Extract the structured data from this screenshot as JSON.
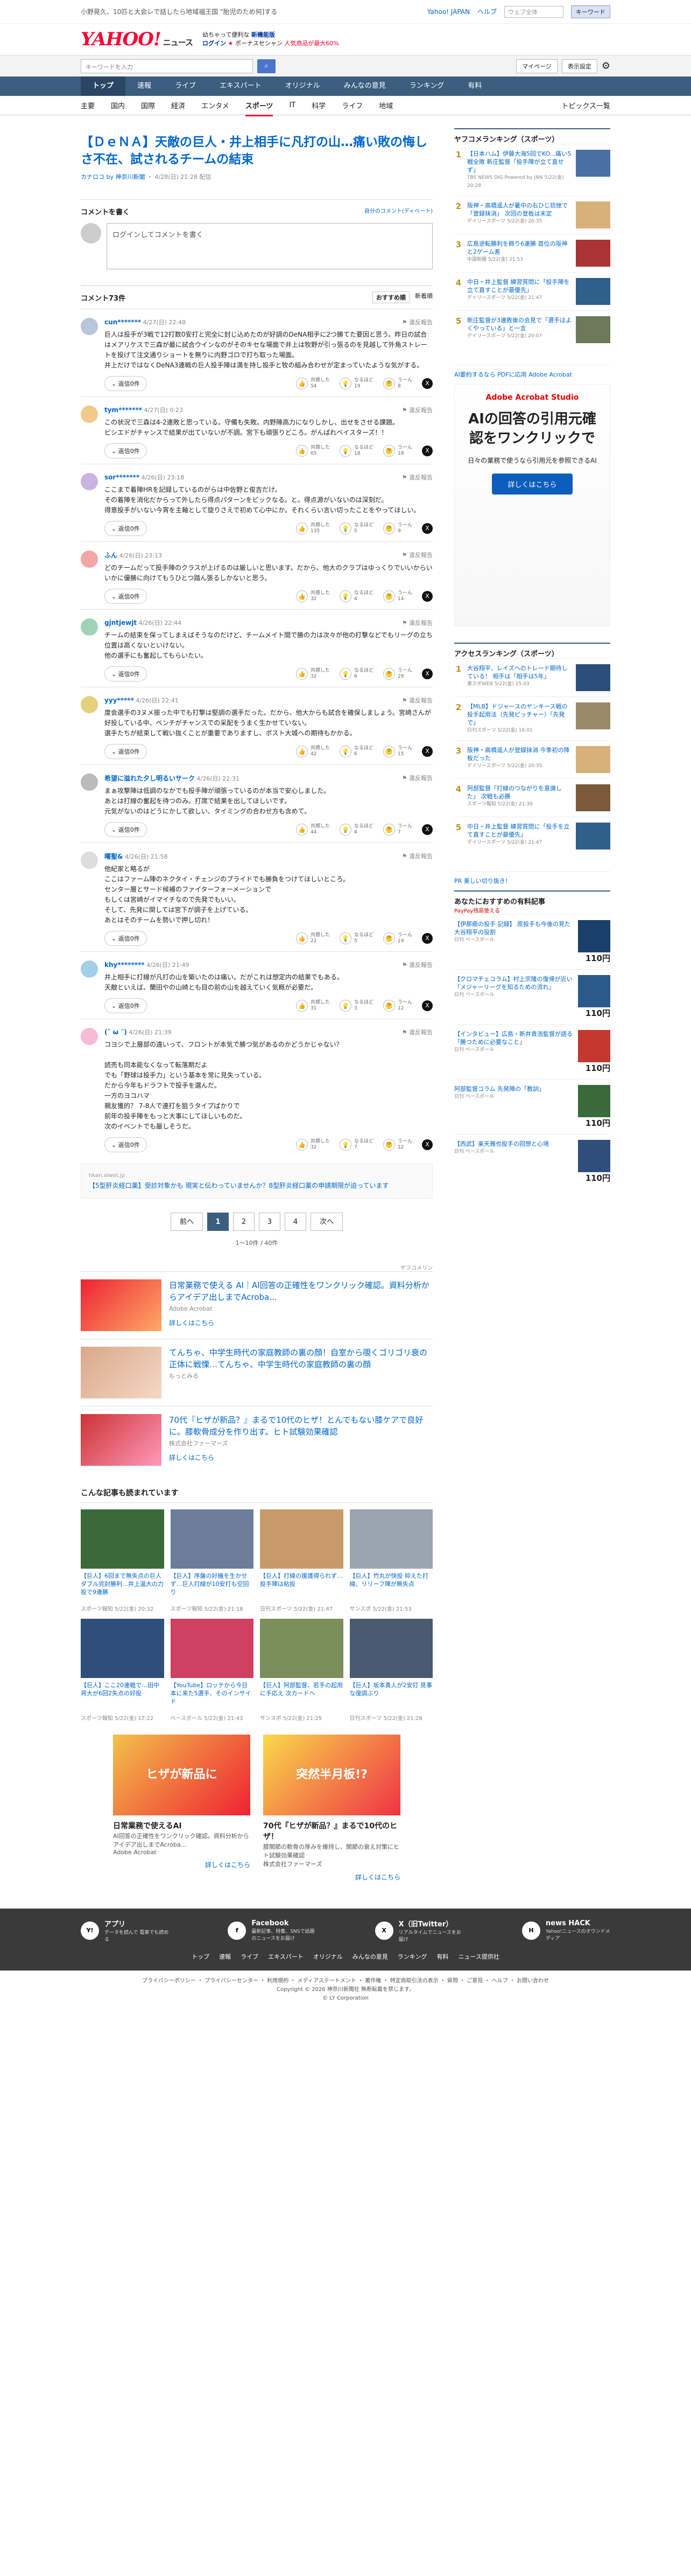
{
  "top": {
    "left": "小野晃久、10匹と大会レで話したら地域福王国 \"胎児のため何]する",
    "yahoo_link": "Yahoo! JAPAN",
    "help": "ヘルプ",
    "search_placeholder": "ウェブ全体",
    "search_btn": "キーワード"
  },
  "brand": {
    "logo": "YAHOO!",
    "logo_sub": "ニュース",
    "line1": "幼ちゃって便利な",
    "line1b": "新機能版",
    "login": "ログイン",
    "line2": "ポーナスセシャン",
    "line2b": "人気商品が最大60%"
  },
  "searchrow": {
    "placeholder": "キーワードを入力",
    "mypage": "マイページ",
    "settings": "表示設定"
  },
  "navmain": [
    "トップ",
    "速報",
    "ライブ",
    "エキスパート",
    "オリジナル",
    "みんなの意見",
    "ランキング",
    "有料"
  ],
  "navmain_active": 0,
  "navsub": [
    "主要",
    "国内",
    "国際",
    "経済",
    "エンタメ",
    "スポーツ",
    "IT",
    "科学",
    "ライフ",
    "地域"
  ],
  "navsub_active": 5,
  "navsub_tail": "トピックス一覧",
  "article": {
    "title": "【ＤｅＮＡ】天敵の巨人・井上相手に凡打の山…痛い敗の悔しさ不在、試されるチームの結束",
    "source": "カナロコ by 神奈川新聞",
    "date": "4/28(日) 21:28 配信"
  },
  "comment_box": {
    "title": "コメントを書く",
    "link": "自分のコメント(ディベート)",
    "placeholder": "ログインしてコメントを書く"
  },
  "comments_head": {
    "title": "コメント73件",
    "sort_a": "おすすめ順",
    "sort_b": "新着順"
  },
  "labels": {
    "reply": "返信0件",
    "report": "違反報告",
    "react1": "共感した",
    "react2": "なるほど",
    "react3": "うーん"
  },
  "comments": [
    {
      "user": "cun*******",
      "date": "4/27(日) 22:48",
      "text": "巨人は投手が3戦で12打数0安打と完全に封じ込めたのが好調のDeNA相手に2つ勝てた要因と思う。昨日の試合はメアリケスで三森が最に試合ウインなのがそのキセな場面で井上は牧野が引っ張るのを見越して外角ストレートを投げて注文通りショートを無りに内野ゴロで打ち取った場面。\n井上だけではなくDeNA3連戦の巨人投手陣は満を持し投手と牧の組み合わせが定まっていたような気がする。",
      "r1": "54",
      "r2": "19",
      "r3": "8"
    },
    {
      "user": "tym*******",
      "date": "4/27(日) 0:23",
      "text": "この状況で三森は4-2連敗と思っている。守備も失敗。内野陣高力になりしかし、出せをさせる課題。\nビシエドがチャンスで結果が出ていないが不調。宮下も頑張りどころ。がんばれベイスターズ！！",
      "r1": "65",
      "r2": "18",
      "r3": "18"
    },
    {
      "user": "sor*******",
      "date": "4/26(日) 23:18",
      "text": "ここまで着陣HRを記録しているのがらは中佐野と俊吉だけ。\nその着陣を消化だからって外したら得点パターンをビックなる。と。得点源がいないのは深刻だ。\n得意投手がいない今宵を主軸として旋りさえで初めて心中にか。それくらい言い切ったことをやってほしい。",
      "r1": "135",
      "r2": "5",
      "r3": "9"
    },
    {
      "user": "ふん",
      "date": "4/26(日) 23:13",
      "text": "どのチームだって投手陣のクラスが上げるのは厳しいと思います。だから、他大のクラブはゆっくりでいいからいいかに優勝に向けてもうひとつ踏ん張るしかないと思う。",
      "r1": "32",
      "r2": "4",
      "r3": "14"
    },
    {
      "user": "gjntjewjt",
      "date": "4/26(日) 22:44",
      "text": "チームの結束を保ってしまえばそうなのだけど、チームメイト間で勝の力は次々が他の打撃などでもリーグの立ち位置は高くないといけない。\n他の選手にも奮起してもらいたい。",
      "r1": "32",
      "r2": "6",
      "r3": "29"
    },
    {
      "user": "yyy*****",
      "date": "4/26(日) 22:41",
      "text": "度会選手の3ヌメ振った中でも打撃は堅調の選手だった。だから、他大からも試合を確保しましょう。宮崎さんが好投している中、ベンチがチャンスでの采配をうまく生かせていない。\n選手たちが結束して戦い抜くことが重要でありますし、ポスト大城への期待もかかる。",
      "r1": "42",
      "r2": "6",
      "r3": "15"
    },
    {
      "user": "希望に溢れた夕し明るいサーク",
      "date": "4/26(日) 22:31",
      "text": "まぁ攻撃陣は低調のなかでも投手陣が頑張っているのが本当で安心しました。\nあとは打線の奮起を待つのみ。打席で結果を出してほしいです。\n元気がないのはどうにかして欲しい、タイミングの合わせ方も含めて。",
      "r1": "44",
      "r2": "4",
      "r3": "7"
    },
    {
      "user": "曙聖&",
      "date": "4/26(日) 21:58",
      "text": "他紀家と略るが\nここはファーム陣のネクタイ・チェンジのプライドでも勝負をつけてほしいところ。\nセンター層とサード候補のファイターフォーメーションで\nもしくは宮崎がイマイチなので先発でもいい。\nそして、先発に関しては宮下が調子を上げている。\nあとはそのチームを勢いで押し切れ！",
      "r1": "22",
      "r2": "5",
      "r3": "19"
    },
    {
      "user": "khy********",
      "date": "4/26(日) 21:49",
      "text": "井上相手に打線が凡打の山を築いたのは痛い。だがこれは想定内の結果でもある。\n天敵といえば、蘭田やの山崎とも目の前の山を越えていく気概が必要だ。",
      "r1": "31",
      "r2": "3",
      "r3": "12"
    },
    {
      "user": "(ˆ ω ˆ)",
      "date": "4/26(日) 21:39",
      "text": "コヨシで上層部の違いって、フロントが本気で勝つ気があるのかどうかじゃない？\n\n読売も同本能なくなって転落期だよ\nでも「野球は投手力」という基本を常に見失っている。\nだから今年もドラフトで投手を選んだ。\n一方のヨコハマ\n親友獲的？ 7-8人で連打を狙うタイプばかりで\n前年の投手陣をもっと大事にしてほしいものだ。\n次のイベントでも厳しそうだ。",
      "r1": "32",
      "r2": "7",
      "r3": "12"
    }
  ],
  "notice": {
    "source": "hkan.alwet.jp",
    "text": "【5型肝炎経口薬】受診対象かも 現実と伝わっていませんか？8型肝炎経口薬の申請期限が迫っています"
  },
  "pager": {
    "prev": "前へ",
    "next": "次へ",
    "pages": [
      "1",
      "2",
      "3",
      "4"
    ],
    "count": "1〜10件 / 40件"
  },
  "ads": {
    "label": "ヤフコメリン",
    "items": [
      {
        "title": "日常業務で使える AI｜AI回答の正確性をワンクリック確認。資料分析からアイデア出しまでAcroba...",
        "src": "Adobe Acrobat",
        "more": "詳しくはこちら"
      },
      {
        "title": "てんちゃ、中学生時代の家庭教師の裏の顔！自室から覗くゴリゴリ衰の正体に戦慄…てんちゃ、中学生時代の家庭教師の裏の顔",
        "src": "もっとみる",
        "more": ""
      },
      {
        "title": "70代『ヒザが新品？』まるで10代のヒザ！とんでもない膝ケアで良好に。膝軟骨成分を作り出す。ヒト試験効果確認",
        "src": "株式会社ファーマーズ",
        "more": "詳しくはこちら"
      }
    ]
  },
  "related": {
    "title": "こんな記事も読まれています",
    "items": [
      {
        "t": "【巨人】6回まで無失点の巨人ダブル完封勝利…井上温大の力投で9連勝",
        "s": "スポーツ報知 5/22(金) 20:32"
      },
      {
        "t": "【巨人】序盤の好機を生かせず…巨人打線が10安打も空回り",
        "s": "スポーツ報知 5/22(金) 21:18"
      },
      {
        "t": "【巨人】打線の援護得られず…投手陣は粘投",
        "s": "日刊スポーツ 5/22(金) 21:47"
      },
      {
        "t": "【巨人】竹丸が快投 抑えた打線、リリーフ陣が無失点",
        "s": "サンスポ 5/22(金) 21:53"
      },
      {
        "t": "【巨人】ここ20連戦で…田中将大が6回2失点の好投",
        "s": "スポーツ報知 5/22(金) 17:22"
      },
      {
        "t": "【YouTube】ロッテから今日本に来た5選手、そのインサイド",
        "s": "ベースボール 5/22(金) 21:43"
      },
      {
        "t": "【巨人】阿部監督、若手の起用に手応え 次カードへ",
        "s": "サンスポ 5/22(金) 21:25"
      },
      {
        "t": "【巨人】坂本勇人が2安打 見事な復調ぶり",
        "s": "日刊スポーツ 5/22(金) 21:28"
      }
    ]
  },
  "bigads": [
    {
      "t": "日常業務で使えるAI",
      "d": "AI回答の正確性をワンクリック確認。資料分析からアイデア出しまでAcroba...",
      "src": "Adobe Acrobat",
      "more": "詳しくはこちら",
      "banner": "ヒザが新品に"
    },
    {
      "t": "70代『ヒザが新品？』まるで10代のヒザ！",
      "d": "膝関節の軟骨の厚みを維持し、関節の衰え対策にヒト試験効果確認",
      "src": "株式会社ファーマーズ",
      "more": "詳しくはこちら",
      "banner": "突然半月板!?"
    }
  ],
  "side": {
    "rank_title": "ヤフコメランキング（スポーツ）",
    "ranking": [
      {
        "n": "1",
        "t": "【日本ハム】伊藤大海5回でKO...痛い5戦全敗 新庄監督「投手陣が立て直せず」",
        "s": "TBS NEWS DIG Powered by JNN 5/22(金) 20:28"
      },
      {
        "n": "2",
        "t": "阪神・高橋遥人が暑中の右ひじ捻挫で「登録抹消」 次回の登板は未定",
        "s": "デイリースポーツ 5/22(金) 20:35"
      },
      {
        "n": "3",
        "t": "広島逆転勝利を飾り6連勝 首位の阪神と2ゲーム差",
        "s": "中国新聞 5/22(金) 21:53"
      },
      {
        "n": "4",
        "t": "中日・井上監督 練習質問に「投手陣を立て直すことが最優先」",
        "s": "デイリースポーツ 5/22(金) 21:47"
      },
      {
        "n": "5",
        "t": "新庄監督が3連敗後の会見で「選手はよくやっている」と一言",
        "s": "デイリースポーツ 5/22(金) 20:07"
      }
    ],
    "ad_small": "AI要約するなら PDFに応用 Adobe Acrobat",
    "bigad": {
      "brand": "Adobe Acrobat Studio",
      "h": "AIの回答の引用元確認をワンクリックで",
      "d": "日々の業務で使うなら引用元を参照できるAI",
      "b": "詳しくはこちら"
    },
    "access_title": "アクセスランキング（スポーツ）",
    "access": [
      {
        "n": "1",
        "t": "大谷翔平、レイズへのトレード期待している！ 相手は「相手は5年」",
        "s": "東スポWEB 5/22(金) 15:03"
      },
      {
        "n": "2",
        "t": "【MLB】ドジャースのヤンキース戦の投手起用法（先発ピッチャー）「先発で」",
        "s": "日刊スポーツ 5/22(金) 16:01"
      },
      {
        "n": "3",
        "t": "阪神・高橋遥人が登録抹消 今季初の降板だった",
        "s": "デイリースポーツ 5/22(金) 20:35"
      },
      {
        "n": "4",
        "t": "阿部監督「打線のつながりを意識した」 次戦も必勝",
        "s": "スポーツ報知 5/22(金) 21:30"
      },
      {
        "n": "5",
        "t": "中日・井上監督 練習質問に「投手を立て直すことが最優先」",
        "s": "デイリースポーツ 5/22(金) 21:47"
      }
    ],
    "pr": "PR 美しい切り抜き！",
    "shop_title": "あなたにおすすめの有料記事",
    "shop_sub": "PayPay残高使える",
    "shops": [
      {
        "t": "【伊那鼎の投手 記録】 原投手も今後の見た大谷翔平の役割",
        "s": "日刊 ベースボール",
        "p": "110円"
      },
      {
        "t": "【クロマチェコラム】村上宗隆の復帰が近い「メジャーリーグを知るための流れ」",
        "s": "日刊 ベースボール",
        "p": "110円"
      },
      {
        "t": "【インタビュー】広島・新井貴浩監督が語る「勝つために必要なこと」",
        "s": "日刊 ベースボール",
        "p": "110円"
      },
      {
        "t": "阿部監督コラム 先発陣の「教訓」",
        "s": "日刊 ベースボール",
        "p": "110円"
      },
      {
        "t": "【西武】楽天雅也投手の回想と心境",
        "s": "日刊 ベースボール",
        "p": "110円"
      }
    ]
  },
  "footer": {
    "apps": [
      {
        "ic": "Y!",
        "t": "アプリ",
        "d": "データを読んで 電車でも読める"
      },
      {
        "ic": "f",
        "t": "Facebook",
        "d": "最新記事、特集、SNSで話題のニュースをお届け"
      },
      {
        "ic": "X",
        "t": "X（旧Twitter）",
        "d": "リアルタイムでニュースをお届け"
      },
      {
        "ic": "H",
        "t": "news HACK",
        "d": "Yahoo!ニュースのオウンドメディア"
      }
    ],
    "nav": [
      "トップ",
      "速報",
      "ライブ",
      "エキスパート",
      "オリジナル",
      "みんなの意見",
      "ランキング",
      "有料",
      "ニュース提供社"
    ],
    "links": "プライバシーポリシー ・ プライバシーセンター ・ 利用規約 ・ メディアステートメント ・ 著作権 ・ 特定商取引法の表示 ・ 質問 ・ ご意見 ・ ヘルプ ・ お問い合わせ",
    "copy": "Copyright © 2026 神奈川新聞社 無断転載を禁じます。",
    "corp": "© LY Corporation"
  }
}
